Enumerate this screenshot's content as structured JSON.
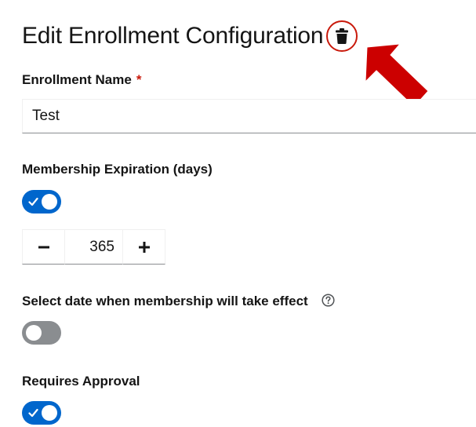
{
  "header": {
    "title": "Edit Enrollment Configuration",
    "delete_icon": "trash-icon"
  },
  "annotation": {
    "arrow_color": "#cc0000"
  },
  "enrollment_name": {
    "label": "Enrollment Name",
    "required_mark": "*",
    "value": "Test"
  },
  "membership_expiration": {
    "label": "Membership Expiration (days)",
    "enabled": true,
    "minus_label": "−",
    "plus_label": "+",
    "days": "365"
  },
  "effective_date": {
    "label": "Select date when membership will take effect",
    "help_icon": "question-circle-icon",
    "enabled": false
  },
  "requires_approval": {
    "label": "Requires Approval",
    "enabled": true
  },
  "colors": {
    "accent": "#0066cc",
    "toggle_off": "#8a8d90",
    "danger": "#c9190b"
  }
}
